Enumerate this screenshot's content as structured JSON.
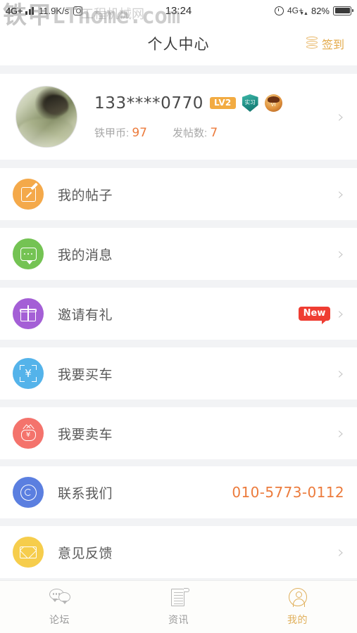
{
  "status_bar": {
    "network_label": "4G+",
    "speed": "11.9K/s",
    "time": "13:24",
    "network_right": "4G+",
    "battery_percent": "82%",
    "signal_icon": "signal-bars-icon",
    "screenshot_icon": "screenshot-icon",
    "alarm_icon": "alarm-clock-icon",
    "battery_icon": "battery-icon"
  },
  "watermark": {
    "cn": "铁甲",
    "en": "LThome.com",
    "sub": "工程机械网"
  },
  "header": {
    "title": "个人中心",
    "signin_label": "签到",
    "signin_icon": "coin-stack-icon"
  },
  "profile": {
    "username": "133****0770",
    "level_badge": "LV2",
    "badge_shield_label": "实习",
    "badge_medal_label": "VI",
    "avatar_icon": "avatar",
    "stats": [
      {
        "label": "铁甲币:",
        "value": "97"
      },
      {
        "label": "发帖数:",
        "value": "7"
      }
    ],
    "chevron": "›"
  },
  "menu": {
    "rows": [
      {
        "label": "我的帖子",
        "icon": "pencil-edit-icon",
        "color": "#f4a94a",
        "value": "",
        "badge": "",
        "chevron": "›"
      },
      {
        "label": "我的消息",
        "icon": "chat-bubble-icon",
        "color": "#74c353",
        "value": "",
        "badge": "",
        "chevron": "›"
      },
      {
        "label": "邀请有礼",
        "icon": "gift-icon",
        "color": "#a濃",
        "value": "",
        "badge": "New",
        "chevron": "›"
      },
      {
        "label": "我要买车",
        "icon": "scan-yuan-icon",
        "color": "#54b3ea",
        "value": "",
        "badge": "",
        "chevron": "›"
      },
      {
        "label": "我要卖车",
        "icon": "money-bag-icon",
        "color": "#f4736c",
        "value": "",
        "badge": "",
        "chevron": "›"
      },
      {
        "label": "联系我们",
        "icon": "headset-icon",
        "color": "#5b7fe0",
        "value": "010-5773-0112",
        "badge": "",
        "chevron": ""
      },
      {
        "label": "意见反馈",
        "icon": "envelope-icon",
        "color": "#f6cd4c",
        "value": "",
        "badge": "",
        "chevron": "›"
      }
    ]
  },
  "tabbar": {
    "tabs": [
      {
        "label": "论坛",
        "icon": "forum-chat-icon",
        "active": false
      },
      {
        "label": "资讯",
        "icon": "news-document-icon",
        "active": false
      },
      {
        "label": "我的",
        "icon": "user-profile-icon",
        "active": true
      }
    ]
  },
  "colors": {
    "accent_gold": "#e0b05c",
    "accent_orange": "#ec7b3c",
    "badge_red": "#ef3d32",
    "level_orange": "#f2ab42",
    "page_bg": "#f2f3f5"
  }
}
